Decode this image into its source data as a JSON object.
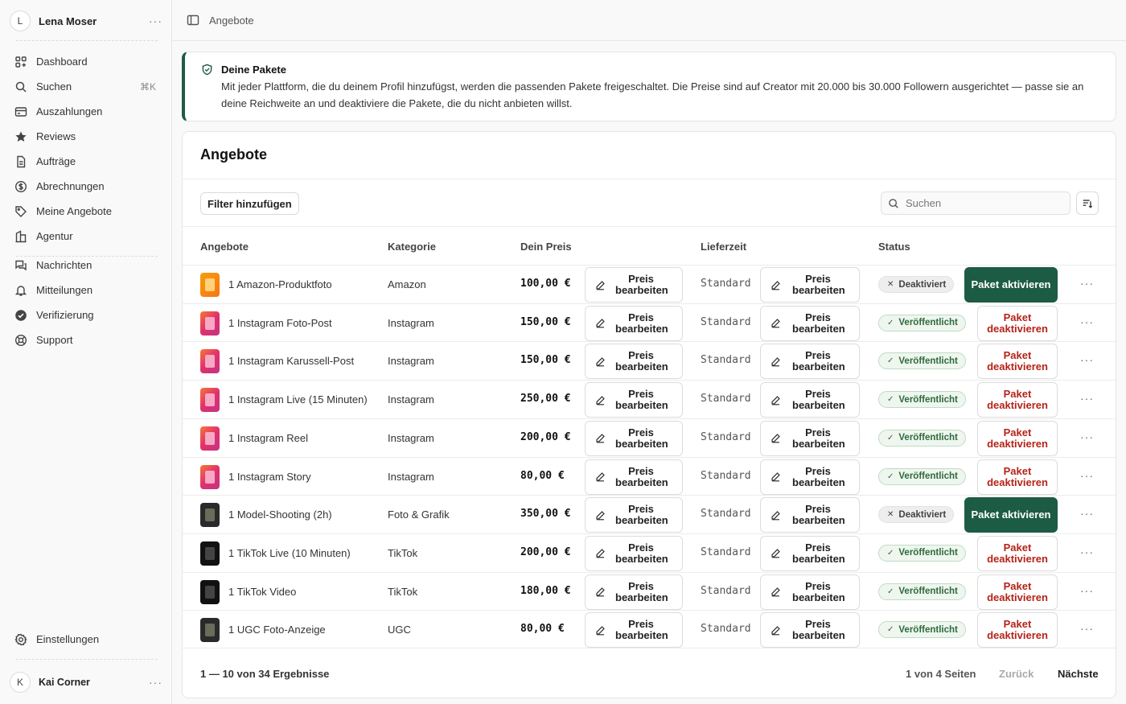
{
  "workspace": {
    "initial": "L",
    "name": "Lena Moser",
    "menu": "···"
  },
  "nav": {
    "dashboard": "Dashboard",
    "search": "Suchen",
    "search_shortcut": "⌘K",
    "payouts": "Auszahlungen",
    "reviews": "Reviews",
    "orders": "Aufträge",
    "billing": "Abrechnungen",
    "offers": "Meine Angebote",
    "agency": "Agentur",
    "messages": "Nachrichten",
    "notifications": "Mitteilungen",
    "verification": "Verifizierung",
    "support": "Support",
    "settings": "Einstellungen"
  },
  "user": {
    "initial": "K",
    "name": "Kai Corner",
    "menu": "···"
  },
  "breadcrumb": "Angebote",
  "notice": {
    "title": "Deine Pakete",
    "text": "Mit jeder Plattform, die du deinem Profil hinzufügst, werden die passenden Pakete freigeschaltet. Die Preise sind auf Creator mit 20.000 bis 30.000 Followern ausgerichtet — passe sie an deine Reichweite an und deaktiviere die Pakete, die du nicht anbieten willst."
  },
  "card": {
    "title": "Angebote",
    "filter_button": "Filter hinzufügen",
    "search_placeholder": "Suchen"
  },
  "table": {
    "headers": {
      "offer": "Angebote",
      "category": "Kategorie",
      "price": "Dein Preis",
      "lead_time": "Lieferzeit",
      "status": "Status"
    },
    "edit_label": "Preis bearbeiten",
    "activate_label": "Paket aktivieren",
    "deactivate_label": "Paket deaktivieren",
    "rows": [
      {
        "name": "1 Amazon-Produktfoto",
        "category": "Amazon",
        "price": "100,00 €",
        "lead_time": "Standard",
        "status": "Deaktiviert",
        "published": false,
        "thumb": "amazon"
      },
      {
        "name": "1 Instagram Foto-Post",
        "category": "Instagram",
        "price": "150,00 €",
        "lead_time": "Standard",
        "status": "Veröffentlicht",
        "published": true,
        "thumb": "instagram"
      },
      {
        "name": "1 Instagram Karussell-Post",
        "category": "Instagram",
        "price": "150,00 €",
        "lead_time": "Standard",
        "status": "Veröffentlicht",
        "published": true,
        "thumb": "instagram"
      },
      {
        "name": "1 Instagram Live (15 Minuten)",
        "category": "Instagram",
        "price": "250,00 €",
        "lead_time": "Standard",
        "status": "Veröffentlicht",
        "published": true,
        "thumb": "instagram"
      },
      {
        "name": "1 Instagram Reel",
        "category": "Instagram",
        "price": "200,00 €",
        "lead_time": "Standard",
        "status": "Veröffentlicht",
        "published": true,
        "thumb": "instagram"
      },
      {
        "name": "1 Instagram Story",
        "category": "Instagram",
        "price": "80,00 €",
        "lead_time": "Standard",
        "status": "Veröffentlicht",
        "published": true,
        "thumb": "instagram"
      },
      {
        "name": "1 Model-Shooting (2h)",
        "category": "Foto & Grafik",
        "price": "350,00 €",
        "lead_time": "Standard",
        "status": "Deaktiviert",
        "published": false,
        "thumb": "photo"
      },
      {
        "name": "1 TikTok Live (10 Minuten)",
        "category": "TikTok",
        "price": "200,00 €",
        "lead_time": "Standard",
        "status": "Veröffentlicht",
        "published": true,
        "thumb": "tiktok"
      },
      {
        "name": "1 TikTok Video",
        "category": "TikTok",
        "price": "180,00 €",
        "lead_time": "Standard",
        "status": "Veröffentlicht",
        "published": true,
        "thumb": "tiktok"
      },
      {
        "name": "1 UGC Foto-Anzeige",
        "category": "UGC",
        "price": "80,00 €",
        "lead_time": "Standard",
        "status": "Veröffentlicht",
        "published": true,
        "thumb": "photo"
      }
    ]
  },
  "pagination": {
    "summary": "1 — 10 von 34 Ergebnisse",
    "pages": "1 von 4 Seiten",
    "prev": "Zurück",
    "next": "Nächste"
  },
  "colors": {
    "accent": "#1d5c44",
    "danger": "#b42318",
    "published_bg": "#eef6ef",
    "thumb_amazon": "#f59e0b",
    "thumb_instagram": "#e1306c",
    "thumb_tiktok": "#111111",
    "thumb_photo": "#2a2a2a"
  }
}
